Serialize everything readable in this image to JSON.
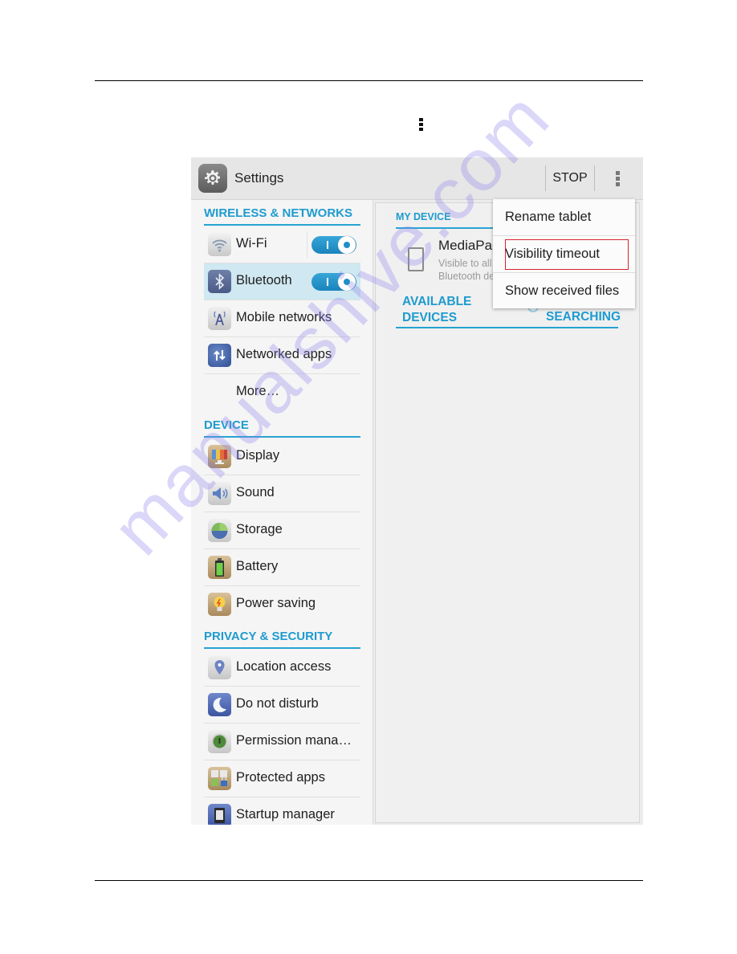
{
  "document": {
    "inline_glyph_icon": "overflow-menu-icon",
    "watermark": "manualshive.com"
  },
  "actionbar": {
    "app_icon": "settings-gear-icon",
    "title": "Settings",
    "stop_label": "STOP",
    "overflow_icon": "overflow-menu-icon"
  },
  "sidebar": {
    "sections": [
      {
        "header": "WIRELESS & NETWORKS",
        "items": [
          {
            "label": "Wi-Fi",
            "icon": "wifi-icon",
            "toggle": "on"
          },
          {
            "label": "Bluetooth",
            "icon": "bluetooth-icon",
            "toggle": "on",
            "selected": true
          },
          {
            "label": "Mobile networks",
            "icon": "antenna-icon"
          },
          {
            "label": "Networked apps",
            "icon": "globe-arrows-icon"
          },
          {
            "label": "More…",
            "icon": ""
          }
        ]
      },
      {
        "header": "DEVICE",
        "items": [
          {
            "label": "Display",
            "icon": "display-icon"
          },
          {
            "label": "Sound",
            "icon": "speaker-icon"
          },
          {
            "label": "Storage",
            "icon": "pie-chart-icon"
          },
          {
            "label": "Battery",
            "icon": "battery-icon"
          },
          {
            "label": "Power saving",
            "icon": "lightbulb-icon"
          }
        ]
      },
      {
        "header": "PRIVACY & SECURITY",
        "items": [
          {
            "label": "Location access",
            "icon": "location-pin-icon"
          },
          {
            "label": "Do not disturb",
            "icon": "moon-icon"
          },
          {
            "label": "Permission mana…",
            "icon": "permission-shield-icon"
          },
          {
            "label": "Protected apps",
            "icon": "lock-apps-icon"
          },
          {
            "label": "Startup manager",
            "icon": "startup-manager-icon"
          }
        ]
      }
    ]
  },
  "content": {
    "my_device_header": "MY DEVICE",
    "device_name": "MediaPad",
    "device_sub_line1": "Visible to all nearby",
    "device_sub_line2": "Bluetooth devices",
    "available_line1": "AVAILABLE",
    "available_line2": "DEVICES",
    "searching": "SEARCHING"
  },
  "popup_menu": {
    "items": [
      "Rename tablet",
      "Visibility timeout",
      "Show received files"
    ],
    "highlighted_index": 1
  },
  "colors": {
    "accent": "#1e9bcf",
    "highlight_box": "#d9232d",
    "selected_row": "#cfe8f1"
  }
}
